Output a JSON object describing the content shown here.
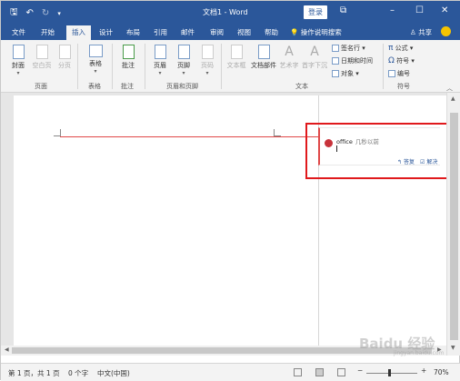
{
  "window": {
    "title": "文档1 - Word",
    "login_label": "登录",
    "accent": "#2b579a"
  },
  "qat": {
    "save_icon": "save-icon",
    "undo_icon": "undo-icon",
    "redo_icon": "redo-icon",
    "customize_icon": "customize-qat-icon"
  },
  "tabs": [
    {
      "label": "文件"
    },
    {
      "label": "开始"
    },
    {
      "label": "插入",
      "active": true
    },
    {
      "label": "设计"
    },
    {
      "label": "布局"
    },
    {
      "label": "引用"
    },
    {
      "label": "邮件"
    },
    {
      "label": "审阅"
    },
    {
      "label": "视图"
    },
    {
      "label": "帮助"
    }
  ],
  "tell_me": "操作说明搜索",
  "share_label": "共享",
  "ribbon": {
    "groups": {
      "pages": "页面",
      "tables": "表格",
      "comments": "批注",
      "header_footer": "页眉和页脚",
      "text": "文本",
      "symbols": "符号"
    },
    "buttons": {
      "cover": "封面",
      "blank_page": "空白页",
      "page_break": "分页",
      "table": "表格",
      "comment": "批注",
      "header": "页眉",
      "footer": "页脚",
      "page_number": "页码",
      "textbox": "文本框",
      "doc_parts": "文档部件",
      "wordart": "艺术字",
      "dropcap": "首字下沉",
      "signature": "签名行",
      "datetime": "日期和时间",
      "object": "对象",
      "equation": "公式",
      "symbol": "符号",
      "numbering": "编号"
    }
  },
  "comment": {
    "author": "office",
    "time": "几秒以前",
    "reply_label": "答复",
    "resolve_label": "解决"
  },
  "status": {
    "page": "第 1 页，共 1 页",
    "words": "0 个字",
    "language": "中文(中国)",
    "zoom": "70%"
  },
  "watermark": {
    "text": "Baidu 经验",
    "sub": "jingyan.baidu.com"
  }
}
